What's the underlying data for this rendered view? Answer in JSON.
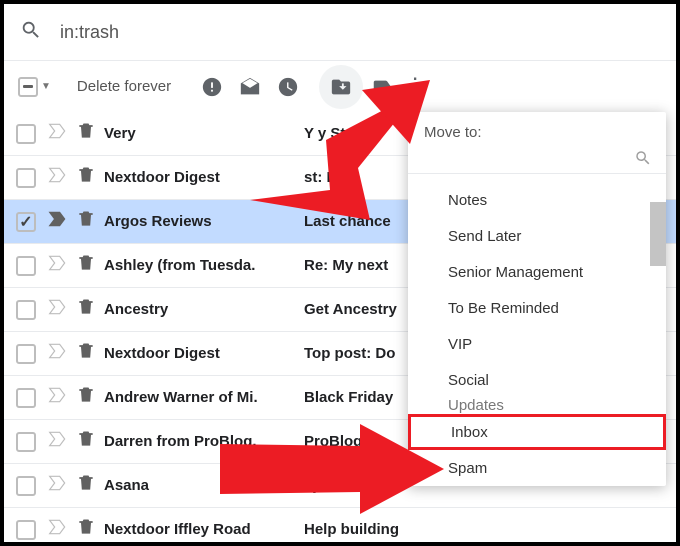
{
  "search": {
    "value": "in:trash"
  },
  "toolbar": {
    "delete_label": "Delete forever"
  },
  "rows": [
    {
      "sender": "Very",
      "subject": "Y       y St",
      "selected": false,
      "important": false
    },
    {
      "sender": "Nextdoor Digest",
      "subject": "        st: Lo",
      "selected": false,
      "important": false
    },
    {
      "sender": "Argos Reviews",
      "subject": "Last chance",
      "selected": true,
      "important": true
    },
    {
      "sender": "Ashley (from Tuesda.",
      "subject": "Re: My next",
      "selected": false,
      "important": false
    },
    {
      "sender": "Ancestry",
      "subject": "Get Ancestry",
      "selected": false,
      "important": false
    },
    {
      "sender": "Nextdoor Digest",
      "subject": "Top post: Do",
      "selected": false,
      "important": false
    },
    {
      "sender": "Andrew Warner of Mi.",
      "subject": "Black Friday",
      "selected": false,
      "important": false
    },
    {
      "sender": "Darren from ProBlog.",
      "subject": "    ProBlog",
      "selected": false,
      "important": false
    },
    {
      "sender": "Asana",
      "subject": "          ay",
      "selected": false,
      "important": false
    },
    {
      "sender": "Nextdoor Iffley Road",
      "subject": "Help building",
      "selected": false,
      "important": false
    }
  ],
  "popup": {
    "title": "Move to:",
    "items": [
      {
        "label": "Notes",
        "highlight": false
      },
      {
        "label": "Send Later",
        "highlight": false
      },
      {
        "label": "Senior Management",
        "highlight": false
      },
      {
        "label": "To Be Reminded",
        "highlight": false
      },
      {
        "label": "VIP",
        "highlight": false
      },
      {
        "label": "Social",
        "highlight": false
      },
      {
        "label": "Updates",
        "highlight": false,
        "clipped": true
      },
      {
        "label": "Inbox",
        "highlight": true
      },
      {
        "label": "Spam",
        "highlight": false
      }
    ]
  }
}
